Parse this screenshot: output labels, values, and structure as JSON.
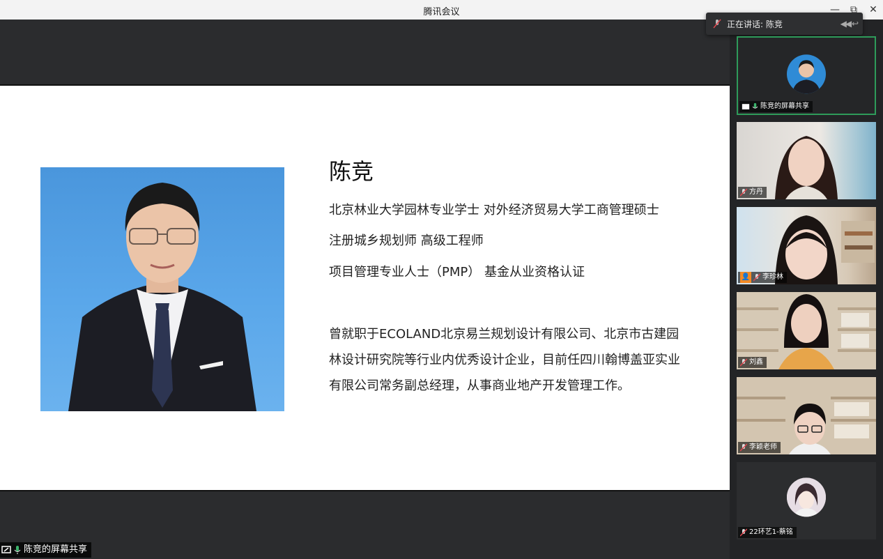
{
  "window": {
    "title": "腾讯会议",
    "minimize": "—",
    "restore": "⧉",
    "close": "✕"
  },
  "speaking": {
    "prefix": "正在讲话: 陈竞"
  },
  "slide": {
    "name": "陈竞",
    "lines": [
      "北京林业大学园林专业学士  对外经济贸易大学工商管理硕士",
      "注册城乡规划师  高级工程师",
      "项目管理专业人士（PMP）  基金从业资格认证"
    ],
    "bio": "曾就职于ECOLAND北京易兰规划设计有限公司、北京市古建园林设计研究院等行业内优秀设计企业，目前任四川翰博盖亚实业有限公司常务副总经理，从事商业地产开发管理工作。"
  },
  "share_label": "陈竞的屏幕共享",
  "participants": [
    {
      "name": "陈竞的屏幕共享",
      "state": "sharing"
    },
    {
      "name": "方丹",
      "state": "muted"
    },
    {
      "name": "李珍林",
      "state": "muted"
    },
    {
      "name": "刘鑫",
      "state": "muted"
    },
    {
      "name": "李颖老师",
      "state": "muted"
    },
    {
      "name": "22环艺1-蔡铭",
      "state": "muted"
    }
  ],
  "colors": {
    "accent_green": "#3bb36b",
    "selected_border": "#2e9b5a",
    "muted_red": "#e0464e"
  }
}
